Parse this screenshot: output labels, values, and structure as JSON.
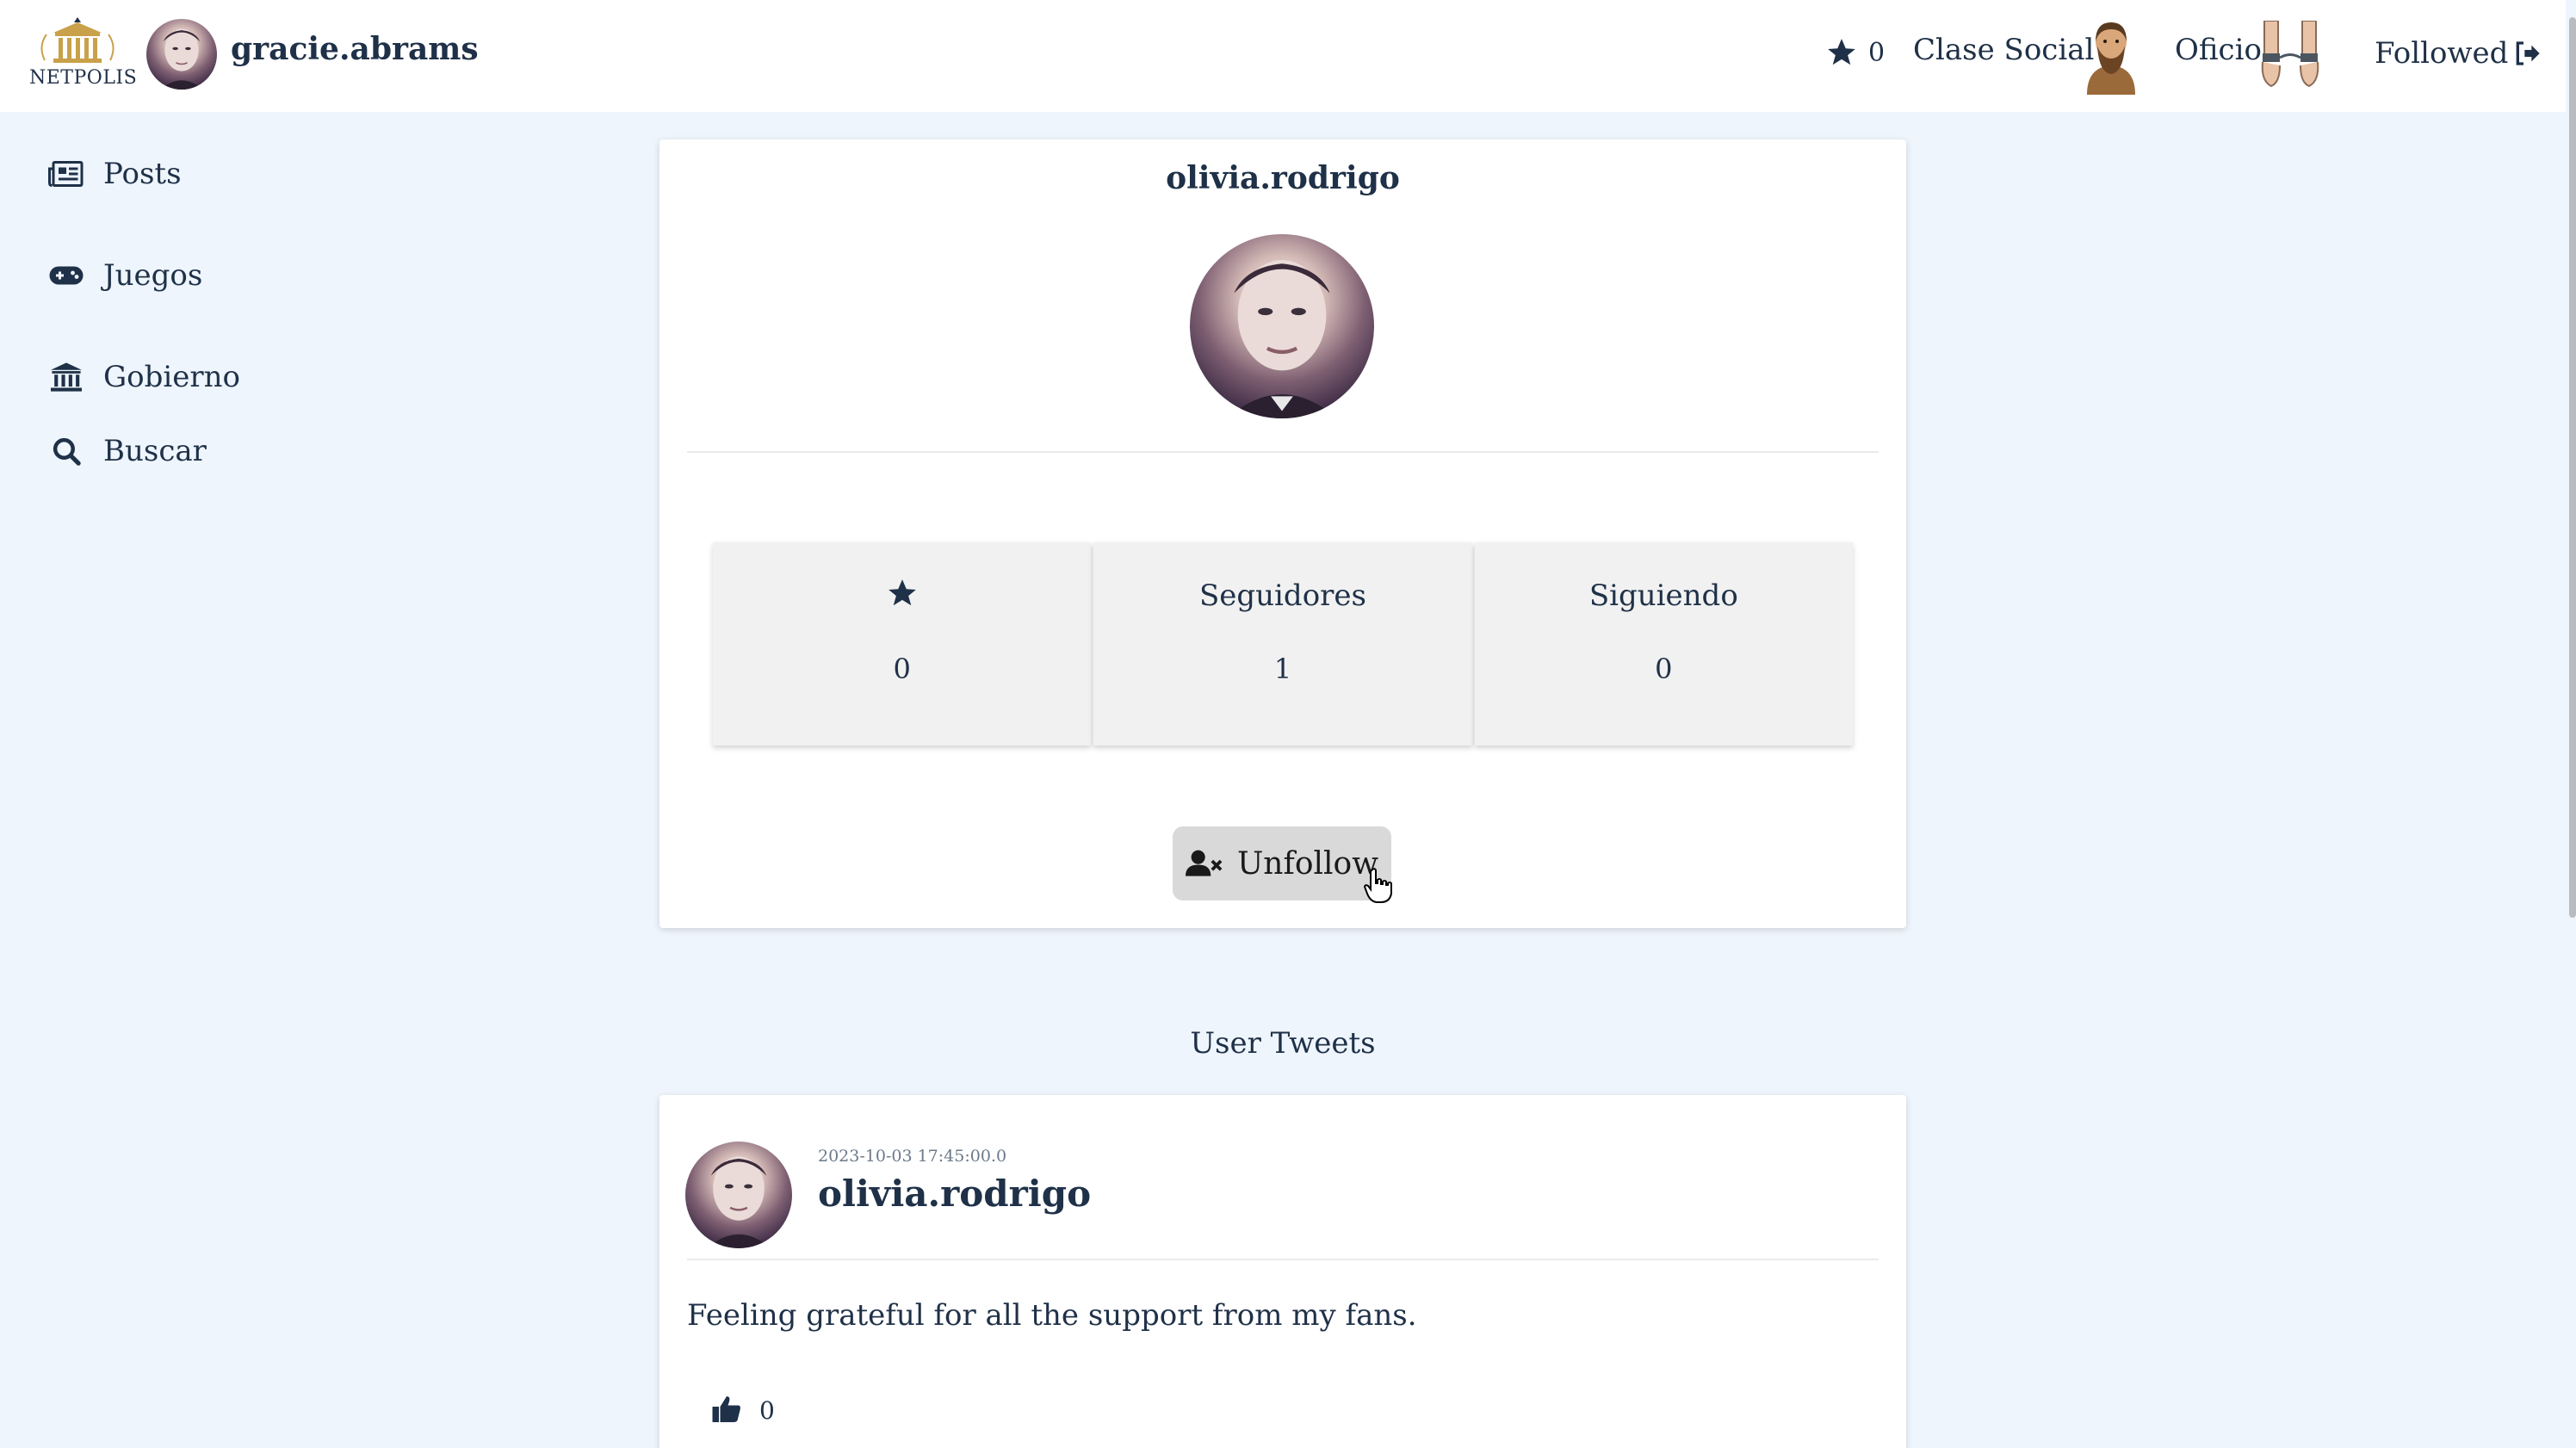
{
  "header": {
    "logo_text": "NETPOLIS",
    "username": "gracie.abrams",
    "star_count": "0",
    "clase_social_label": "Clase Social",
    "oficio_label": "Oficio",
    "followed_label": "Followed"
  },
  "sidebar": {
    "items": [
      {
        "label": "Posts",
        "icon": "newspaper-icon"
      },
      {
        "label": "Juegos",
        "icon": "gamepad-icon"
      },
      {
        "label": "Gobierno",
        "icon": "landmark-icon"
      },
      {
        "label": "Buscar",
        "icon": "search-icon"
      }
    ]
  },
  "profile": {
    "username": "olivia.rodrigo",
    "stats": {
      "stars_value": "0",
      "followers_label": "Seguidores",
      "followers_value": "1",
      "following_label": "Siguiendo",
      "following_value": "0"
    },
    "unfollow_label": "Unfollow"
  },
  "tweets_section": {
    "title": "User Tweets",
    "tweets": [
      {
        "date": "2023-10-03 17:45:00.0",
        "username": "olivia.rodrigo",
        "text": "Feeling grateful for all the support from my fans.",
        "likes": "0"
      }
    ]
  },
  "colors": {
    "background": "#eef5fc",
    "text": "#1f3148",
    "card": "#ffffff",
    "button": "#d9d9d9"
  }
}
